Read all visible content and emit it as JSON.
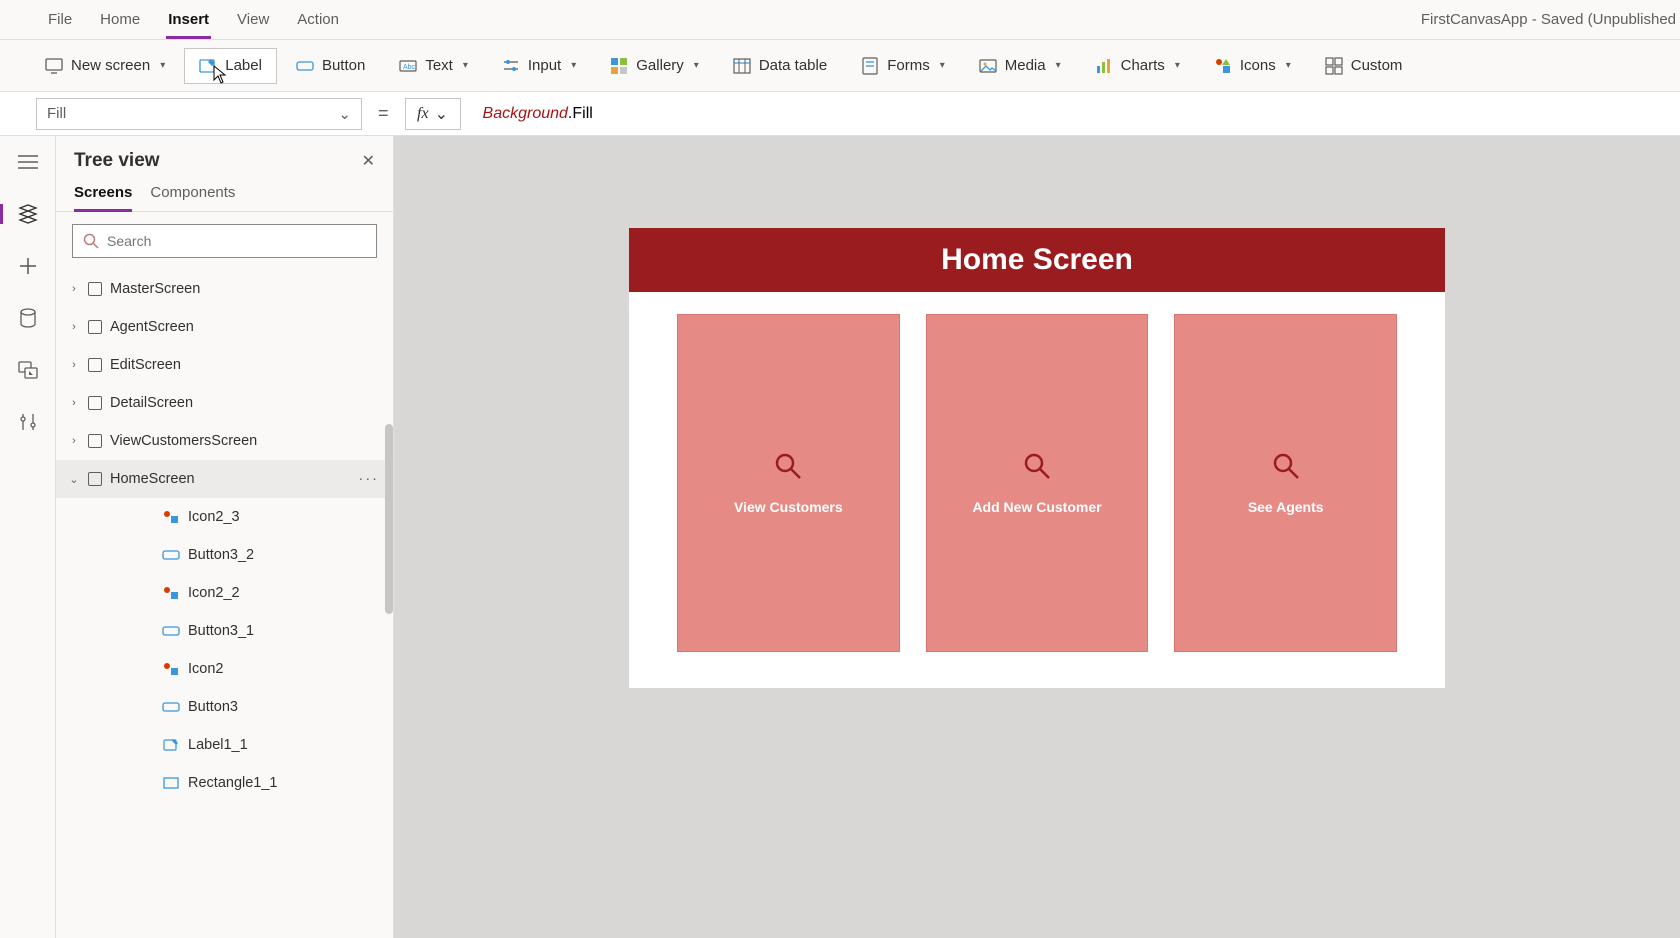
{
  "app_title": "FirstCanvasApp - Saved (Unpublished",
  "menubar": {
    "file": "File",
    "home": "Home",
    "insert": "Insert",
    "view": "View",
    "action": "Action"
  },
  "ribbon": {
    "newscreen": "New screen",
    "label": "Label",
    "button": "Button",
    "text": "Text",
    "input": "Input",
    "gallery": "Gallery",
    "datatable": "Data table",
    "forms": "Forms",
    "media": "Media",
    "charts": "Charts",
    "icons": "Icons",
    "custom": "Custom"
  },
  "property_selector": "Fill",
  "formula": {
    "object": "Background",
    "dot": ".",
    "prop": "Fill"
  },
  "tree": {
    "title": "Tree view",
    "tabs": {
      "screens": "Screens",
      "components": "Components"
    },
    "search_placeholder": "Search",
    "items": [
      {
        "label": "MasterScreen"
      },
      {
        "label": "AgentScreen"
      },
      {
        "label": "EditScreen"
      },
      {
        "label": "DetailScreen"
      },
      {
        "label": "ViewCustomersScreen"
      },
      {
        "label": "HomeScreen"
      }
    ],
    "children": [
      {
        "label": "Icon2_3",
        "kind": "icon"
      },
      {
        "label": "Button3_2",
        "kind": "button"
      },
      {
        "label": "Icon2_2",
        "kind": "icon"
      },
      {
        "label": "Button3_1",
        "kind": "button"
      },
      {
        "label": "Icon2",
        "kind": "icon"
      },
      {
        "label": "Button3",
        "kind": "button"
      },
      {
        "label": "Label1_1",
        "kind": "label"
      },
      {
        "label": "Rectangle1_1",
        "kind": "rect"
      }
    ]
  },
  "canvas": {
    "header": "Home Screen",
    "cards": [
      {
        "label": "View Customers"
      },
      {
        "label": "Add New Customer"
      },
      {
        "label": "See Agents"
      }
    ]
  },
  "colors": {
    "accent": "#8a2da5",
    "brand_header": "#9b1c1f",
    "card_bg": "#e68a85"
  }
}
